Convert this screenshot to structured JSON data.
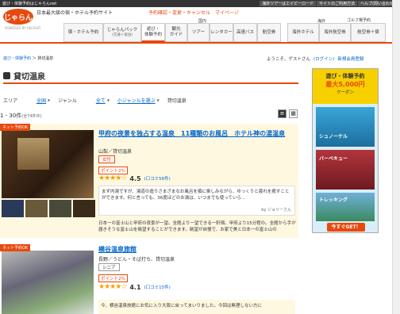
{
  "topbar": {
    "left_text": "遊び・体験予約はじゃらんnet",
    "right_links": [
      "海外ツアーはエイビーロード",
      "サイトのご利用方法",
      "ヘルプ(問い合わせ)"
    ]
  },
  "header": {
    "logo_text": "じゃらん",
    "logo_sub": "POWERED BY RECRUIT",
    "tagline": "日本最大級の宿・ホテル予約サイト",
    "links": "予約確認・変更・キャンセル　マイページ",
    "golf_link": "ゴルフ場予約"
  },
  "nav": {
    "domestic_label": "国内",
    "overseas_label": "海外",
    "items": [
      {
        "label": "宿・ホテル予約",
        "sub": ""
      },
      {
        "label": "じゃらんパック",
        "sub": "(交通＋宿泊)"
      },
      {
        "label": "遊び・",
        "sub": "体験予約"
      },
      {
        "label": "観光",
        "sub": "ガイド"
      },
      {
        "label": "ツアー",
        "sub": ""
      },
      {
        "label": "レンタカー",
        "sub": ""
      },
      {
        "label": "高速バス",
        "sub": ""
      },
      {
        "label": "航空券",
        "sub": ""
      },
      {
        "label": "海外ホテル",
        "sub": ""
      },
      {
        "label": "海外航空券",
        "sub": ""
      },
      {
        "label": "航空券＋宿",
        "sub": ""
      }
    ]
  },
  "breadcrumb": {
    "root": "遊び・体験予約",
    "current": "貸切温泉"
  },
  "welcome": {
    "text": "ようこそ、ゲストさん",
    "login": "(ログイン)",
    "register": "新規会員登録"
  },
  "page_title": "貸切温泉",
  "filters": {
    "area_label": "エリア",
    "area_value": "全国",
    "genre_label": "ジャンル",
    "genre_value": "全て",
    "subgenre_value": "小ジャンルを選ぶ",
    "current": "貸切温泉"
  },
  "count": {
    "range": "1 - 30件",
    "total": "(全74件中)"
  },
  "listings": [
    {
      "badge": "ネット予約OK",
      "name": "甲府の夜景を独占する温泉　11種類のお風呂　ホテル神の湯温泉",
      "location": "山梨／貸切温泉",
      "tag": "女性",
      "point": "ポイント2%",
      "stars": "★★★★☆",
      "score": "4.5",
      "reviews": "(口コミ58件)",
      "review_text": "まず内湯ですが、湯道の造りさまざまなお風呂を順に楽しみながら、ゆっくりと疲れを癒すことができます。何と言っても、36度ほどのお湯は、いつまでも使っていら…",
      "review_by": "by ジョリーさん",
      "description": "日本一の富士山と甲府の夜景が一望。全館より一望できる一軒宿。甲府より15分程の。全館から手が届きそうな富士山を眺望することができます。眺望が自慢で、お家で美と日本一の富士山の"
    },
    {
      "badge": "ネット予約OK",
      "name": "横谷温泉旅館",
      "location": "長野／うどん・そば打ち、貸切温泉",
      "tag": "シニア",
      "point": "ポイント2%",
      "stars": "★★★★☆",
      "score": "4.1",
      "reviews": "(口コミ15件)",
      "review_text": "今、横谷温泉旅館にお気に入り大阪に戻ってまいりました。今回は無理しない方に"
    }
  ],
  "ad": {
    "line1": "遊び・体験予約",
    "line2": "最大5,000円",
    "line3": "クーポン",
    "labels": [
      "シュノーケル",
      "バーベキュー",
      "トレッキング"
    ],
    "cta": "今すぐGET！"
  },
  "colors": {
    "accent": "#e8480c",
    "link": "#0066cc",
    "highlight_bg": "#fff8e1"
  }
}
